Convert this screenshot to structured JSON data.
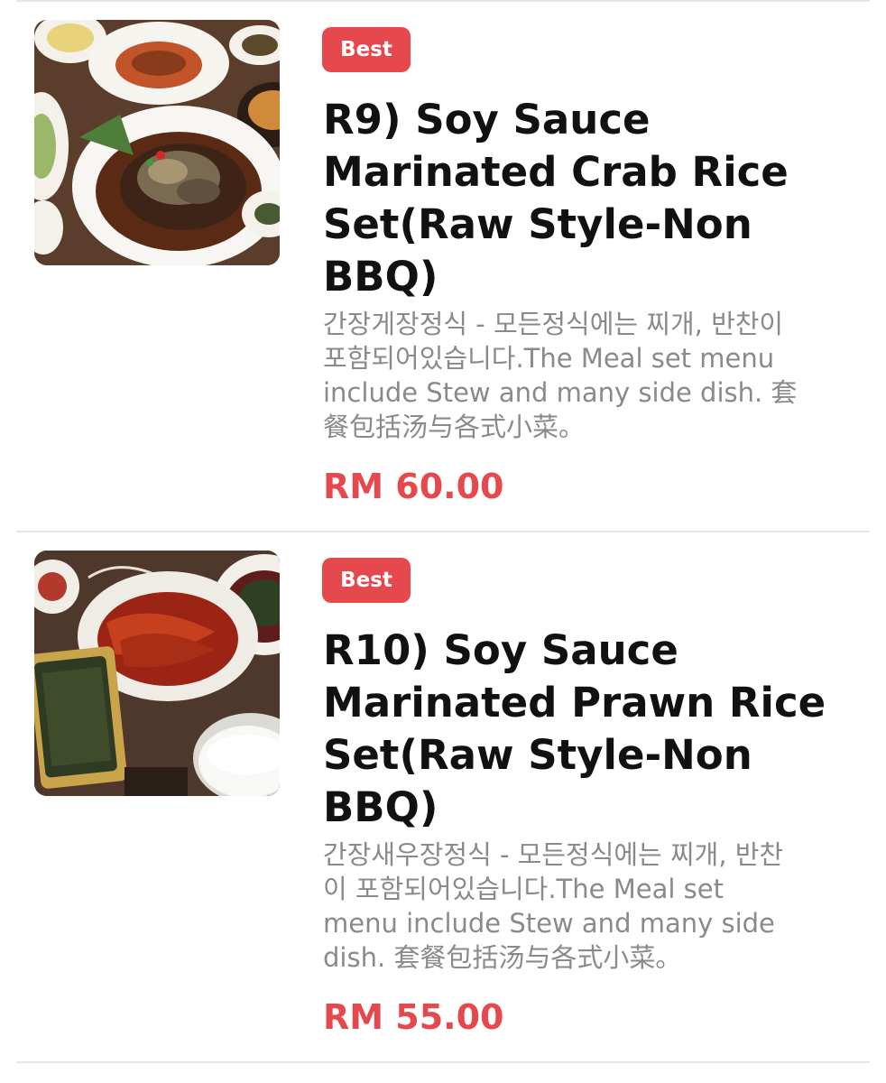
{
  "menu_items": [
    {
      "badge": "Best",
      "title_lines": [
        "R9) Soy Sauce",
        "Marinated Crab Rice",
        "Set(Raw Style-Non",
        "BBQ)"
      ],
      "description_lines": [
        "간장게장정식 - 모든정식에는 찌개, 반찬이",
        "포함되어있습니다.The Meal set menu",
        "include Stew and many side dish. 套",
        "餐包括汤与各式小菜。"
      ],
      "price": "RM 60.00",
      "image_icon": "crab-rice-set-photo"
    },
    {
      "badge": "Best",
      "title_lines": [
        "R10) Soy Sauce",
        "Marinated Prawn Rice",
        "Set(Raw Style-Non",
        "BBQ)"
      ],
      "description_lines": [
        "간장새우장정식 - 모든정식에는 찌개, 반찬",
        "이 포함되어있습니다.The Meal set",
        "menu include Stew and many side",
        "dish. 套餐包括汤与各式小菜。"
      ],
      "price": "RM 55.00",
      "image_icon": "prawn-rice-set-photo"
    }
  ],
  "colors": {
    "accent": "#e5484d",
    "title": "#111111",
    "description": "#8a8a8a",
    "divider": "#e6e6e6"
  }
}
